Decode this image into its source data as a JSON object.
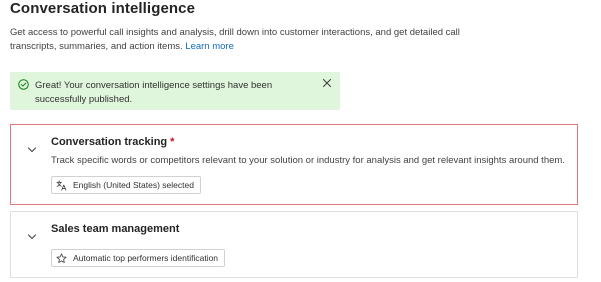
{
  "header": {
    "title": "Conversation intelligence",
    "description": "Get access to powerful call insights and analysis, drill down into customer interactions, and get detailed call transcripts, summaries, and action items.",
    "learn_more": "Learn more"
  },
  "banner": {
    "message": "Great! Your conversation intelligence settings have been successfully published.",
    "icon": "checkmark-circle-icon",
    "color": "#dff6dd"
  },
  "sections": {
    "tracking": {
      "title": "Conversation tracking",
      "required_mark": "*",
      "description": "Track specific words or competitors relevant to your solution or industry for analysis and get relevant insights around them.",
      "chip_label": "English (United States) selected",
      "chip_icon": "language-icon"
    },
    "sales": {
      "title": "Sales team management",
      "chip_label": "Automatic top performers identification",
      "chip_icon": "star-icon"
    }
  },
  "colors": {
    "accent_link": "#0f6cbd",
    "error_border": "#e0787b",
    "success_bg": "#dff6dd",
    "required": "#c50f1f"
  }
}
